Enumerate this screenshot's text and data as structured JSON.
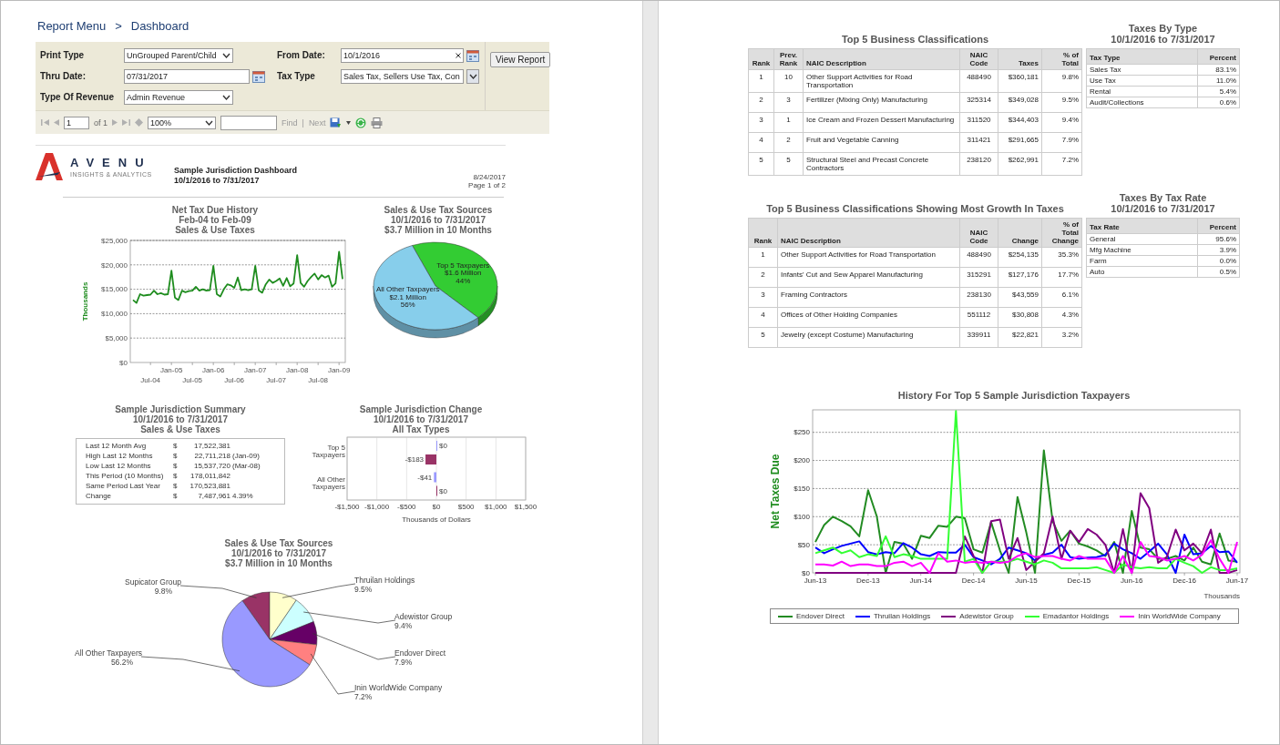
{
  "breadcrumb": {
    "items": [
      "Report Menu",
      "Dashboard"
    ],
    "separator": ">"
  },
  "parameters": {
    "fields": [
      {
        "label": "Print Type",
        "kind": "select",
        "value": "UnGrouped Parent/Child"
      },
      {
        "label": "From Date:",
        "kind": "date",
        "value": "10/1/2016",
        "clearable": true
      },
      {
        "label": "Thru Date:",
        "kind": "date",
        "value": "07/31/2017",
        "clearable": false
      },
      {
        "label": "Tax Type",
        "kind": "multiselect",
        "value": "Sales Tax, Sellers Use Tax, Con"
      },
      {
        "label": "Type Of Revenue",
        "kind": "select",
        "value": "Admin Revenue"
      }
    ],
    "button": "View Report"
  },
  "toolbar": {
    "page": "1",
    "page_count": "of 1",
    "zoom": "100%",
    "find": "Find",
    "separator": "|",
    "next": "Next"
  },
  "logo": {
    "wordmark": "AVENU",
    "tagline": "INSIGHTS & ANALYTICS"
  },
  "report": {
    "title": "Sample Jurisdiction Dashboard",
    "date_range": "10/1/2016 to 7/31/2017",
    "print_date": "8/24/2017",
    "page": "Page 1 of 2"
  },
  "net_tax_history": {
    "title_lines": [
      "Net Tax Due History",
      "Feb-04 to Feb-09",
      "Sales & Use Taxes"
    ],
    "chart_data": {
      "type": "line",
      "ylabel": "Thousands",
      "ylim": [
        0,
        25000
      ],
      "yticks": [
        {
          "value": 0,
          "label": "$0"
        },
        {
          "value": 5000,
          "label": "$5,000"
        },
        {
          "value": 10000,
          "label": "$10,000"
        },
        {
          "value": 15000,
          "label": "$15,000"
        },
        {
          "value": 20000,
          "label": "$20,000"
        },
        {
          "value": 25000,
          "label": "$25,000"
        }
      ],
      "grid": true,
      "categories": [
        null,
        null,
        null,
        null,
        null,
        "Jul-04",
        null,
        null,
        null,
        null,
        null,
        "Jan-05",
        null,
        null,
        null,
        null,
        null,
        "Jul-05",
        null,
        null,
        null,
        null,
        null,
        "Jan-06",
        null,
        null,
        null,
        null,
        null,
        "Jul-06",
        null,
        null,
        null,
        null,
        null,
        "Jan-07",
        null,
        null,
        null,
        null,
        null,
        "Jul-07",
        null,
        null,
        null,
        null,
        null,
        "Jan-08",
        null,
        null,
        null,
        null,
        null,
        "Jul-08",
        null,
        null,
        null,
        null,
        null,
        "Jan-09",
        null
      ],
      "series": [
        {
          "color": "#1e8c1e",
          "values": [
            12800,
            12200,
            14000,
            13700,
            13800,
            13900,
            14700,
            14000,
            14200,
            13900,
            14000,
            18800,
            13300,
            12800,
            14700,
            14400,
            14600,
            14700,
            15500,
            14700,
            15000,
            14700,
            14800,
            19800,
            14000,
            13500,
            15000,
            16000,
            15800,
            15300,
            17400,
            14800,
            15000,
            14800,
            15000,
            19800,
            14800,
            14300,
            16000,
            17000,
            16300,
            16700,
            17200,
            15700,
            17300,
            15600,
            16200,
            22000,
            16300,
            15500,
            16700,
            17500,
            18200,
            17000,
            17900,
            17400,
            17800,
            15500,
            16200,
            22700,
            17100
          ]
        }
      ]
    }
  },
  "tax_sources_pie": {
    "title_lines": [
      "Sales & Use Tax Sources",
      "10/1/2016 to 7/31/2017",
      "$3.7 Million in 10 Months"
    ],
    "chart_data": {
      "type": "pie",
      "categories": [
        "Top 5 Taxpayers",
        "All Other Taxpayers"
      ],
      "values": [
        44,
        56
      ],
      "colors": [
        "#33cc33",
        "#87ceeb"
      ]
    },
    "slice_labels": [
      {
        "amount": "$1.6 Million",
        "percent": "44%"
      },
      {
        "amount": "$2.1 Million",
        "percent": "56%"
      }
    ]
  },
  "summary": {
    "title_lines": [
      "Sample Jurisdiction Summary",
      "10/1/2016 to 7/31/2017",
      "Sales & Use Taxes"
    ],
    "rows": [
      {
        "label": "Last 12 Month Avg",
        "currency": "$",
        "value": "17,522,381"
      },
      {
        "label": "High Last 12 Months",
        "currency": "$",
        "value": "22,711,218",
        "note": "(Jan-09)"
      },
      {
        "label": "Low Last 12 Months",
        "currency": "$",
        "value": "15,537,720",
        "note": "(Mar-08)"
      },
      {
        "label": "This Period (10 Months)",
        "currency": "$",
        "value": "178,011,842"
      },
      {
        "label": "Same Period Last Year",
        "currency": "$",
        "value": "170,523,881"
      },
      {
        "label": "Change",
        "currency": "$",
        "value": "7,487,961",
        "note": "4.39%"
      }
    ]
  },
  "change": {
    "title_lines": [
      "Sample Jurisdiction  Change",
      "10/1/2016 to 7/31/2017",
      "All Tax Types"
    ],
    "chart_data": {
      "type": "bar",
      "orientation": "horizontal",
      "grid": true,
      "categories": [
        "Top 5 Taxpayers",
        "All Other Taxpayers"
      ],
      "xlabel": "Thousands of Dollars",
      "xlim": [
        -1500,
        1500
      ],
      "data_labels": true,
      "xticks": [
        {
          "value": -1500,
          "label": "-$1,500"
        },
        {
          "value": -1000,
          "label": "-$1,000"
        },
        {
          "value": -500,
          "label": "-$500"
        },
        {
          "value": 0,
          "label": "$0"
        },
        {
          "value": 500,
          "label": "$500"
        },
        {
          "value": 1000,
          "label": "$1,000"
        },
        {
          "value": 1500,
          "label": "$1,500"
        }
      ],
      "series": [
        {
          "color": "#9999ff",
          "values": [
            0,
            -41
          ],
          "value_labels": [
            "$0",
            "-$41"
          ]
        },
        {
          "color": "#993366",
          "values": [
            -183,
            0
          ],
          "value_labels": [
            "-$183",
            "$0"
          ]
        }
      ]
    }
  },
  "sources_pie_detail": {
    "title_lines": [
      "Sales & Use Tax Sources",
      "10/1/2016 to 7/31/2017",
      "$3.7 Million in 10 Months"
    ],
    "chart_data": {
      "type": "pie",
      "categories": [
        "Supicator  Group",
        "Thruilan Holdings",
        "Adewistor  Group",
        "Endover Direct",
        "Inin WorldWide Company",
        "All Other Taxpayers"
      ],
      "values": [
        9.8,
        9.5,
        9.4,
        7.9,
        7.2,
        56.2
      ],
      "colors": [
        "#993366",
        "#ffffcc",
        "#ccffff",
        "#660066",
        "#ff8080",
        "#9999ff"
      ]
    },
    "percent_labels": [
      "9.8%",
      "9.5%",
      "9.4%",
      "7.9%",
      "7.2%",
      "56.2%"
    ]
  },
  "top_classifications": {
    "title": "Top 5 Business Classifications",
    "columns": [
      "Rank",
      "Prev. Rank",
      "NAIC Description",
      "NAIC Code",
      "Taxes",
      "% of Total"
    ],
    "rows": [
      [
        "1",
        "10",
        "Other Support Activities for Road Transportation",
        "488490",
        "$360,181",
        "9.8%"
      ],
      [
        "2",
        "3",
        "Fertilizer (Mixing Only) Manufacturing",
        "325314",
        "$349,028",
        "9.5%"
      ],
      [
        "3",
        "1",
        "Ice Cream and Frozen Dessert Manufacturing",
        "311520",
        "$344,403",
        "9.4%"
      ],
      [
        "4",
        "2",
        "Fruit and Vegetable Canning",
        "311421",
        "$291,665",
        "7.9%"
      ],
      [
        "5",
        "5",
        "Structural Steel and Precast Concrete Contractors",
        "238120",
        "$262,991",
        "7.2%"
      ]
    ]
  },
  "taxes_by_type": {
    "title_lines": [
      "Taxes By Type",
      "10/1/2016 to 7/31/2017"
    ],
    "columns": [
      "Tax Type",
      "Percent"
    ],
    "rows": [
      [
        "Sales Tax",
        "83.1%"
      ],
      [
        "Use Tax",
        "11.0%"
      ],
      [
        "Rental",
        "5.4%"
      ],
      [
        "Audit/Collections",
        "0.6%"
      ]
    ]
  },
  "growth_classifications": {
    "title": "Top 5 Business Classifications Showing Most Growth In Taxes",
    "columns": [
      "Rank",
      "NAIC Description",
      "NAIC Code",
      "Change",
      "% of Total Change"
    ],
    "rows": [
      [
        "1",
        "Other Support Activities for Road Transportation",
        "488490",
        "$254,135",
        "35.3%"
      ],
      [
        "2",
        "Infants' Cut and Sew Apparel Manufacturing",
        "315291",
        "$127,176",
        "17.7%"
      ],
      [
        "3",
        "Framing Contractors",
        "238130",
        "$43,559",
        "6.1%"
      ],
      [
        "4",
        "Offices of  Other Holding Companies",
        "551112",
        "$30,808",
        "4.3%"
      ],
      [
        "5",
        "Jewelry (except Costume) Manufacturing",
        "339911",
        "$22,821",
        "3.2%"
      ]
    ]
  },
  "taxes_by_rate": {
    "title_lines": [
      "Taxes By Tax Rate",
      "10/1/2016 to 7/31/2017"
    ],
    "columns": [
      "Tax Rate",
      "Percent"
    ],
    "rows": [
      [
        "General",
        "95.6%"
      ],
      [
        "Mfg Machine",
        "3.9%"
      ],
      [
        "Farm",
        "0.0%"
      ],
      [
        "Auto",
        "0.5%"
      ]
    ]
  },
  "taxpayer_history": {
    "title": "History For Top 5 Sample Jurisdiction Taxpayers",
    "chart_data": {
      "type": "line",
      "ylabel": "Net Taxes Due",
      "xlabel": "Thousands",
      "ylim": [
        0,
        290
      ],
      "yticks": [
        {
          "value": 0,
          "label": "$0"
        },
        {
          "value": 50,
          "label": "$50"
        },
        {
          "value": 100,
          "label": "$100"
        },
        {
          "value": 150,
          "label": "$150"
        },
        {
          "value": 200,
          "label": "$200"
        },
        {
          "value": 250,
          "label": "$250"
        }
      ],
      "grid": true,
      "categories": [
        "Jun-13",
        null,
        null,
        null,
        null,
        null,
        "Dec-13",
        null,
        null,
        null,
        null,
        null,
        "Jun-14",
        null,
        null,
        null,
        null,
        null,
        "Dec-14",
        null,
        null,
        null,
        null,
        null,
        "Jun-15",
        null,
        null,
        null,
        null,
        null,
        "Dec-15",
        null,
        null,
        null,
        null,
        null,
        "Jun-16",
        null,
        null,
        null,
        null,
        null,
        "Dec-16",
        null,
        null,
        null,
        null,
        null,
        "Jun-17"
      ],
      "series": [
        {
          "name": "Endover Direct",
          "color": "#228b22",
          "values": [
            55,
            85,
            100,
            92,
            83,
            65,
            147,
            100,
            0,
            55,
            52,
            25,
            66,
            62,
            84,
            82,
            100,
            97,
            42,
            36,
            90,
            40,
            0,
            135,
            72,
            0,
            218,
            92,
            57,
            75,
            52,
            47,
            40,
            30,
            55,
            0,
            110,
            45,
            42,
            25,
            25,
            30,
            22,
            45,
            20,
            15,
            70,
            22,
            20
          ]
        },
        {
          "name": "Thruilan Holdings",
          "color": "#0000ff",
          "values": [
            45,
            35,
            42,
            48,
            52,
            56,
            37,
            33,
            37,
            35,
            53,
            45,
            33,
            30,
            37,
            36,
            36,
            50,
            28,
            22,
            15,
            25,
            45,
            40,
            35,
            22,
            32,
            36,
            50,
            28,
            25,
            27,
            28,
            32,
            52,
            42,
            35,
            25,
            38,
            52,
            33,
            0,
            68,
            33,
            35,
            48,
            37,
            38,
            18
          ]
        },
        {
          "name": "Adewistor  Group",
          "color": "#800080",
          "values": [
            0,
            0,
            0,
            0,
            0,
            0,
            0,
            0,
            0,
            0,
            0,
            0,
            0,
            0,
            0,
            0,
            0,
            65,
            30,
            0,
            92,
            95,
            25,
            62,
            5,
            20,
            35,
            100,
            25,
            75,
            55,
            78,
            68,
            50,
            0,
            78,
            0,
            142,
            115,
            18,
            28,
            77,
            40,
            52,
            35,
            77,
            0,
            0,
            5
          ]
        },
        {
          "name": "Emadantor Holdings",
          "color": "#33ff33",
          "values": [
            35,
            40,
            45,
            35,
            40,
            28,
            33,
            30,
            65,
            28,
            33,
            30,
            25,
            25,
            25,
            25,
            288,
            20,
            25,
            0,
            20,
            20,
            20,
            25,
            20,
            15,
            22,
            18,
            8,
            8,
            8,
            8,
            10,
            5,
            0,
            15,
            10,
            8,
            10,
            8,
            8,
            25,
            18,
            12,
            0,
            10,
            5,
            5,
            8
          ]
        },
        {
          "name": "Inin WorldWide Company",
          "color": "#ff00ff",
          "values": [
            15,
            15,
            13,
            20,
            12,
            15,
            15,
            12,
            12,
            18,
            20,
            12,
            18,
            0,
            35,
            20,
            22,
            18,
            20,
            18,
            20,
            18,
            20,
            30,
            35,
            28,
            30,
            30,
            25,
            22,
            30,
            25,
            25,
            25,
            0,
            30,
            0,
            55,
            30,
            28,
            22,
            25,
            30,
            22,
            32,
            58,
            25,
            0,
            55
          ]
        }
      ]
    }
  }
}
